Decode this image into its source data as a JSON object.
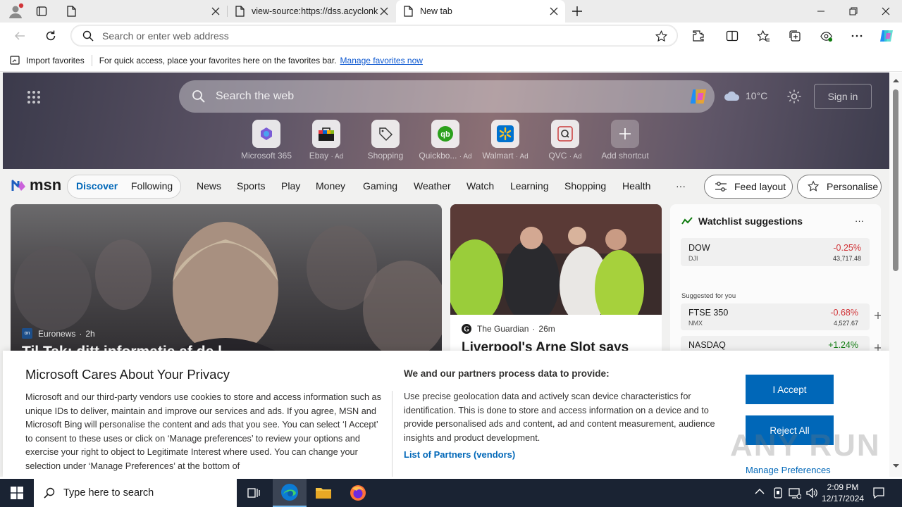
{
  "browser": {
    "tabs": [
      {
        "title": "",
        "active": false
      },
      {
        "title": "view-source:https://dss.acyclonk",
        "active": false
      },
      {
        "title": "New tab",
        "active": true
      }
    ],
    "address_placeholder": "Search or enter web address"
  },
  "favorites_bar": {
    "import_label": "Import favorites",
    "hint": "For quick access, place your favorites here on the favorites bar.",
    "manage_link": "Manage favorites now"
  },
  "newtab": {
    "search_placeholder": "Search the web",
    "weather_temp": "10°C",
    "sign_in": "Sign in",
    "shortcuts": [
      {
        "label": "Microsoft 365",
        "ad": ""
      },
      {
        "label": "Ebay",
        "ad": "· Ad"
      },
      {
        "label": "Shopping",
        "ad": ""
      },
      {
        "label": "Quickbo...",
        "ad": "· Ad"
      },
      {
        "label": "Walmart",
        "ad": "· Ad"
      },
      {
        "label": "QVC",
        "ad": "· Ad"
      },
      {
        "label": "Add shortcut",
        "ad": ""
      }
    ]
  },
  "msn": {
    "logo": "msn",
    "discover": "Discover",
    "following": "Following",
    "nav": [
      "News",
      "Sports",
      "Play",
      "Money",
      "Gaming",
      "Weather",
      "Watch",
      "Learning",
      "Shopping",
      "Health"
    ],
    "more": "···",
    "feed_layout": "Feed layout",
    "personalise": "Personalise"
  },
  "cards": {
    "main": {
      "source": "Euronews",
      "time": "2h",
      "headline": "Til Tak: ditt informatie af de l"
    },
    "second": {
      "source": "The Guardian",
      "time": "26m",
      "headline": "Liverpool's Arne Slot says"
    },
    "watchlist": {
      "title": "Watchlist suggestions",
      "more": "···",
      "top": {
        "name": "DOW",
        "ticker": "DJI",
        "change": "-0.25%",
        "price": "43,717.48"
      },
      "suggested_label": "Suggested for you",
      "suggested": [
        {
          "name": "FTSE 350",
          "ticker": "NMX",
          "change": "-0.68%",
          "price": "4,527.67"
        },
        {
          "name": "NASDAQ",
          "ticker": "",
          "change": "+1.24%",
          "price": ""
        }
      ]
    }
  },
  "privacy": {
    "title": "Microsoft Cares About Your Privacy",
    "body": "Microsoft and our third-party vendors use cookies to store and access information such as unique IDs to deliver, maintain and improve our services and ads. If you agree, MSN and Microsoft Bing will personalise the content and ads that you see. You can select ‘I Accept’ to consent to these uses or click on ‘Manage preferences’ to review your options and exercise your right to object to Legitimate Interest where used.  You can change your selection under ‘Manage Preferences’ at the bottom of",
    "partners_title": "We and our partners process data to provide:",
    "partners_body": "Use precise geolocation data and actively scan device characteristics for identification. This is done to store and access information on a device and to provide personalised ads and content, ad and content measurement, audience insights and product development.",
    "vendors_link": "List of Partners (vendors)",
    "accept": "I Accept",
    "reject": "Reject All",
    "manage": "Manage Preferences",
    "watermark": "ANY RUN"
  },
  "taskbar": {
    "search_placeholder": "Type here to search",
    "time": "2:09 PM",
    "date": "12/17/2024"
  },
  "colors": {
    "accent_blue": "#0067b8",
    "link_blue": "#0b57d0",
    "negative": "#d13438",
    "positive": "#107c10",
    "taskbar": "#1a2333"
  }
}
